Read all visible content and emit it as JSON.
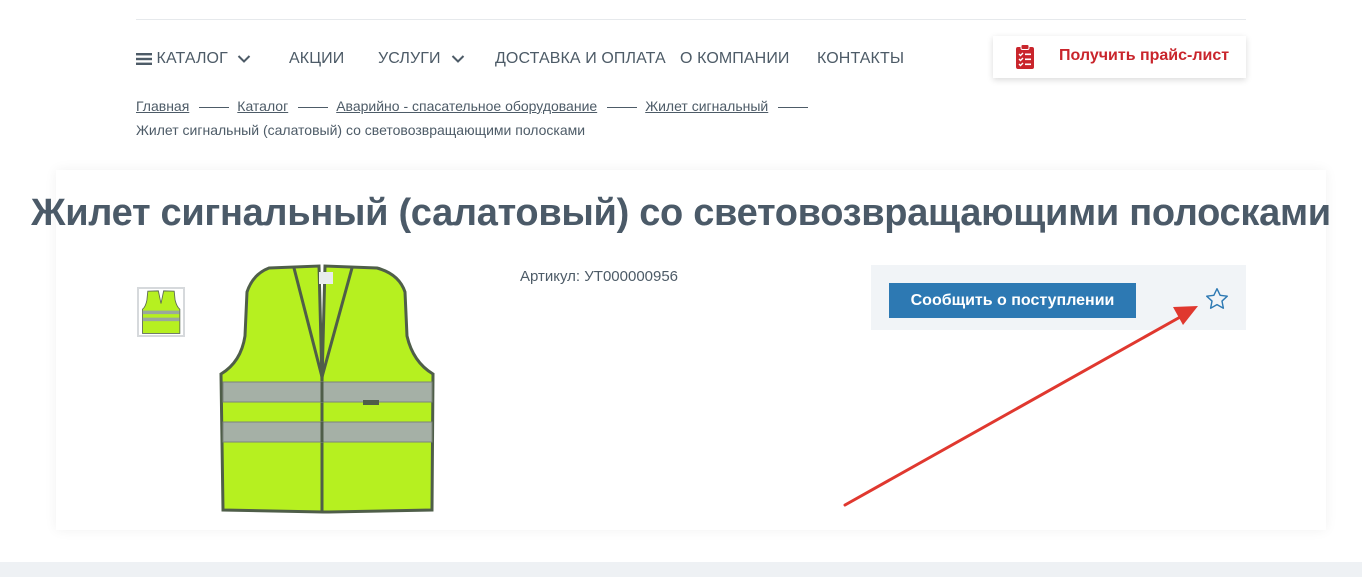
{
  "nav": {
    "catalog": "КАТАЛОГ",
    "promo": "АКЦИИ",
    "services": "УСЛУГИ",
    "delivery": "ДОСТАВКА И ОПЛАТА",
    "about": "О КОМПАНИИ",
    "contacts": "КОНТАКТЫ"
  },
  "price_list": {
    "label": "Получить прайс-лист"
  },
  "breadcrumbs": {
    "items": [
      "Главная",
      "Каталог",
      "Аварийно - спасательное оборудование",
      "Жилет сигнальный"
    ],
    "current": "Жилет сигнальный (салатовый) со световозвращающими полосками"
  },
  "product": {
    "title": "Жилет сигнальный (салатовый) со световозвращающими полосками",
    "sku": "Артикул: УТ000000956",
    "notify_label": "Сообщить о поступлении"
  },
  "colors": {
    "accent_red": "#c9252c",
    "button_blue": "#2d79b3",
    "vest_green": "#b6f020",
    "arrow": "#e0382f"
  },
  "icons": [
    "menu-icon",
    "chevron-down-icon",
    "clipboard-checklist-icon",
    "star-outline-icon"
  ]
}
